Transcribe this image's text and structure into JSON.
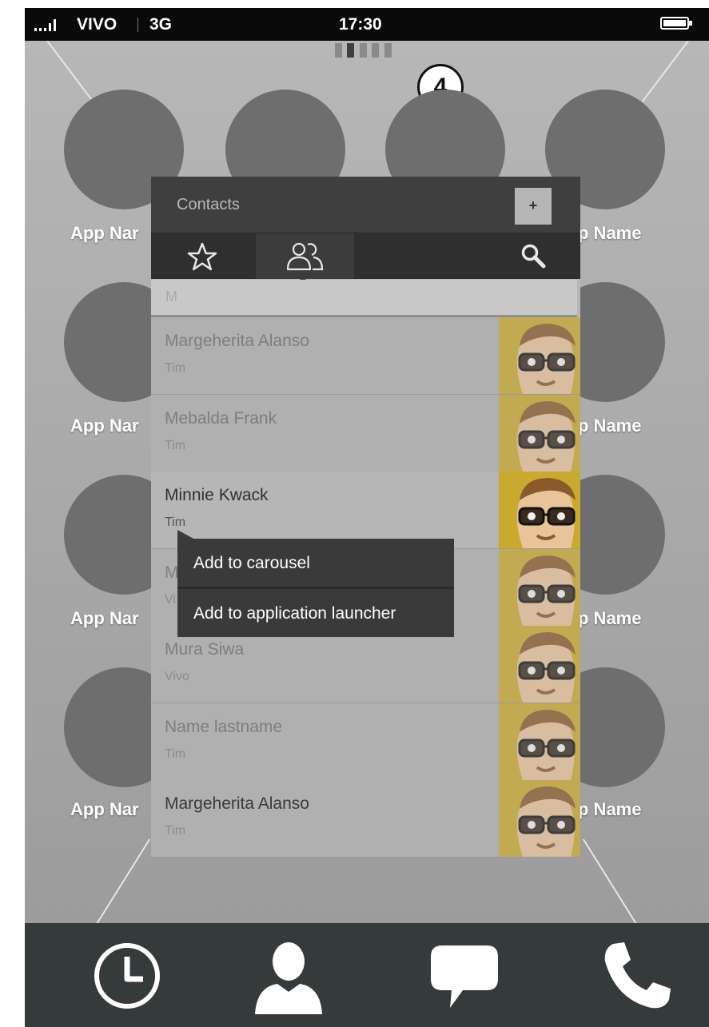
{
  "status_bar": {
    "carrier": "VIVO",
    "network": "3G",
    "time": "17:30"
  },
  "step_badge": "4",
  "home": {
    "app_labels": [
      "App Nar",
      "p Name",
      "App Nar",
      "p Name",
      "App Nar",
      "p Name",
      "App Nar",
      "p Name"
    ]
  },
  "contacts_panel": {
    "title": "Contacts",
    "add_label": "+",
    "tabs": [
      {
        "icon": "star-icon"
      },
      {
        "icon": "contacts-group-icon",
        "active": true
      },
      {
        "icon": "search-icon"
      }
    ],
    "section_letter": "M",
    "contacts": [
      {
        "name": "Margeherita Alanso",
        "sub": "Tim"
      },
      {
        "name": "Mebalda Frank",
        "sub": "Tim"
      },
      {
        "name": "Minnie Kwack",
        "sub": "Tim",
        "selected": true
      },
      {
        "name": "M",
        "sub": "Vi"
      },
      {
        "name": "Mura Siwa",
        "sub": "Vivo"
      },
      {
        "name": "Name lastname",
        "sub": "Tim"
      },
      {
        "name": "Margeherita Alanso",
        "sub": "Tim"
      }
    ]
  },
  "context_menu": {
    "items": [
      "Add to carousel",
      "Add to application launcher"
    ]
  },
  "dock": {
    "icons": [
      "clock-icon",
      "person-icon",
      "chat-bubble-icon",
      "phone-icon"
    ]
  },
  "colors": {
    "photo_background": "#c9a92f",
    "panel_header": "#3f3f3f",
    "dock": "#353a3b"
  }
}
